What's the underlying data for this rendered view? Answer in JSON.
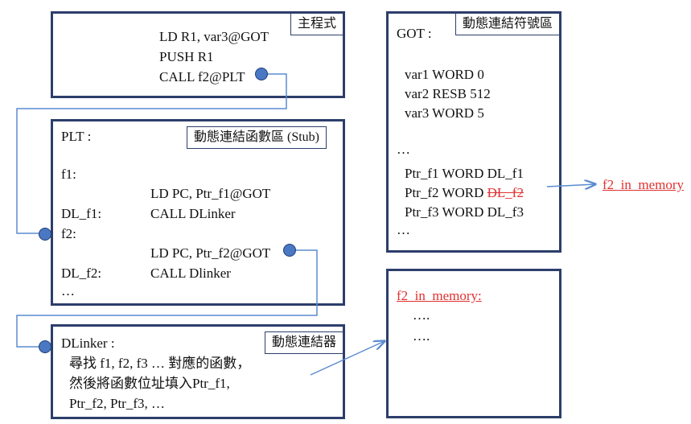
{
  "main_program": {
    "tag": "主程式",
    "lines": [
      "LD R1, var3@GOT",
      "PUSH R1",
      "CALL  f2@PLT"
    ]
  },
  "plt": {
    "title": "PLT :",
    "tag": "動態連結函數區 (Stub)",
    "lines": {
      "f1": "f1:",
      "f1_ld": "LD PC, Ptr_f1@GOT",
      "dl_f1": "DL_f1:",
      "dl_f1_call": "CALL DLinker",
      "f2": "f2:",
      "f2_ld": "LD PC, Ptr_f2@GOT",
      "dl_f2": "DL_f2:",
      "dl_f2_call": "CALL Dlinker",
      "ellipsis": "…"
    }
  },
  "dlinker": {
    "title": "DLinker :",
    "tag": "動態連結器",
    "lines": [
      "尋找 f1, f2, f3 … 對應的函數，",
      "然後將函數位址填入Ptr_f1,",
      "Ptr_f2, Ptr_f3, …"
    ]
  },
  "got": {
    "title": "GOT :",
    "tag": "動態連結符號區",
    "lines": {
      "var1": "var1 WORD  0",
      "var2": "var2 RESB 512",
      "var3": "var3 WORD  5",
      "ellipsis1": "…",
      "ptr_f1": "Ptr_f1 WORD DL_f1",
      "ptr_f2_prefix": "Ptr_f2 WORD ",
      "ptr_f2_struck": "DL_f2",
      "ptr_f3": "Ptr_f3 WORD DL_f3",
      "ellipsis2": "…"
    }
  },
  "memory": {
    "title": "f2_in_memory:",
    "lines": [
      "….",
      "…."
    ]
  },
  "external_label": "f2_in_memory",
  "colors": {
    "border": "#2c3e6b",
    "arrow": "#5b8bd0",
    "highlight": "#e03030",
    "dot": "#4a78c2"
  }
}
